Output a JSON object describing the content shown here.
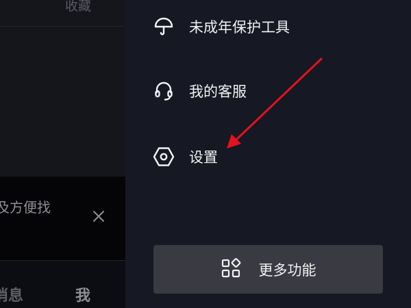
{
  "background_page": {
    "collect_label": "收藏",
    "banner_text": "及方便找",
    "tab_messages": "消息",
    "tab_me": "我"
  },
  "drawer": {
    "items": [
      {
        "label": "未成年保护工具",
        "icon": "umbrella-icon"
      },
      {
        "label": "我的客服",
        "icon": "headset-icon"
      },
      {
        "label": "设置",
        "icon": "hexagon-gear-icon"
      }
    ],
    "more_button": {
      "label": "更多功能",
      "icon": "grid-apps-icon"
    }
  },
  "colors": {
    "drawer_bg": "#161823",
    "button_bg": "#393a42",
    "text": "#f2f2f4",
    "annotation_arrow": "#e3121e"
  }
}
